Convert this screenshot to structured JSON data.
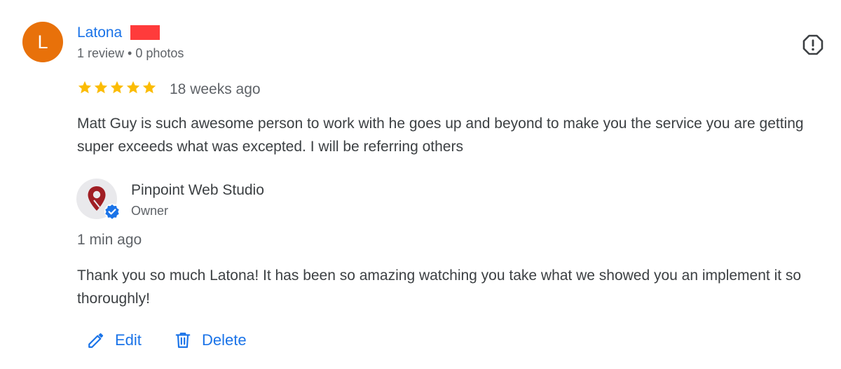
{
  "review": {
    "avatar_letter": "L",
    "avatar_color": "#e8710a",
    "reviewer_name": "Latona",
    "reviewer_meta": "1 review • 0 photos",
    "rating": 5,
    "rating_max": 5,
    "star_color": "#fbbc04",
    "time": "18 weeks ago",
    "text": "Matt Guy is such awesome person to work with he goes up and beyond to make you the service you are getting super exceeds what was excepted. I will be referring others",
    "report_icon": "report-icon"
  },
  "reply": {
    "owner_name": "Pinpoint Web Studio",
    "owner_role": "Owner",
    "owner_logo_icon": "map-pin-icon",
    "verified_icon": "verified-badge-icon",
    "time": "1 min ago",
    "text": "Thank you so much Latona! It has been so amazing watching you take what we showed you an implement it so thoroughly!"
  },
  "actions": {
    "edit_label": "Edit",
    "delete_label": "Delete",
    "edit_icon": "pencil-icon",
    "delete_icon": "trash-icon"
  },
  "colors": {
    "link_blue": "#1a73e8",
    "secondary_text": "#5f6368",
    "redaction": "#ff3b3b",
    "logo_red": "#a01e24"
  }
}
